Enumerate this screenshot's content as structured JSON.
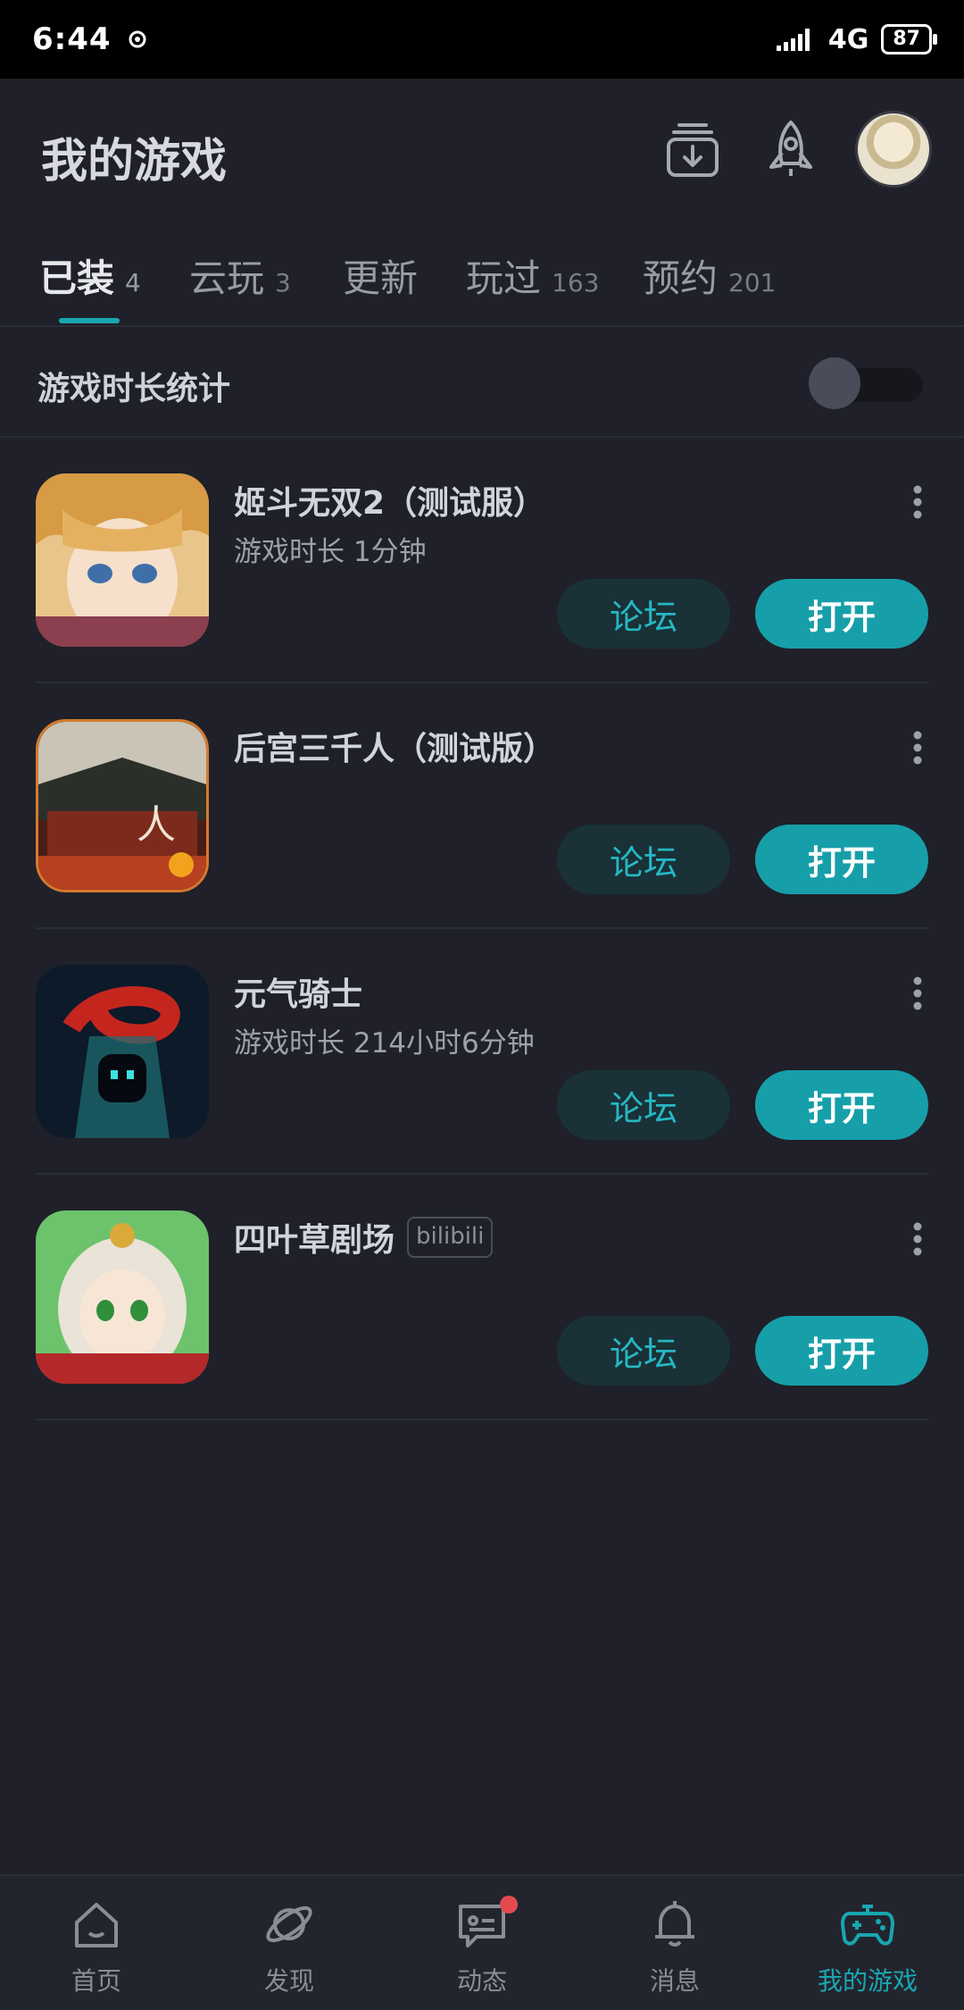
{
  "status_bar": {
    "time": "6:44",
    "network": "4G",
    "battery": "87"
  },
  "header": {
    "title": "我的游戏"
  },
  "tabs": [
    {
      "label": "已装",
      "count": "4",
      "active": true
    },
    {
      "label": "云玩",
      "count": "3"
    },
    {
      "label": "更新",
      "count": ""
    },
    {
      "label": "玩过",
      "count": "163"
    },
    {
      "label": "预约",
      "count": "201"
    }
  ],
  "playtime_stats": {
    "label": "游戏时长统计",
    "enabled": false
  },
  "games": [
    {
      "title": "姬斗无双2（测试服）",
      "tag": "",
      "subtitle": "游戏时长 1分钟",
      "forum": "论坛",
      "open": "打开"
    },
    {
      "title": "后宫三千人（测试版）",
      "tag": "",
      "subtitle": "",
      "forum": "论坛",
      "open": "打开"
    },
    {
      "title": "元气骑士",
      "tag": "",
      "subtitle": "游戏时长 214小时6分钟",
      "forum": "论坛",
      "open": "打开"
    },
    {
      "title": "四叶草剧场",
      "tag": "bilibili",
      "subtitle": "",
      "forum": "论坛",
      "open": "打开"
    }
  ],
  "bottom_nav": [
    {
      "label": "首页",
      "icon": "home-icon"
    },
    {
      "label": "发现",
      "icon": "planet-icon"
    },
    {
      "label": "动态",
      "icon": "chat-icon",
      "badge": true
    },
    {
      "label": "消息",
      "icon": "bell-icon"
    },
    {
      "label": "我的游戏",
      "icon": "gamepad-icon",
      "active": true
    }
  ],
  "colors": {
    "accent": "#179fa9",
    "background": "#1f2029",
    "badge": "#e34a50"
  }
}
